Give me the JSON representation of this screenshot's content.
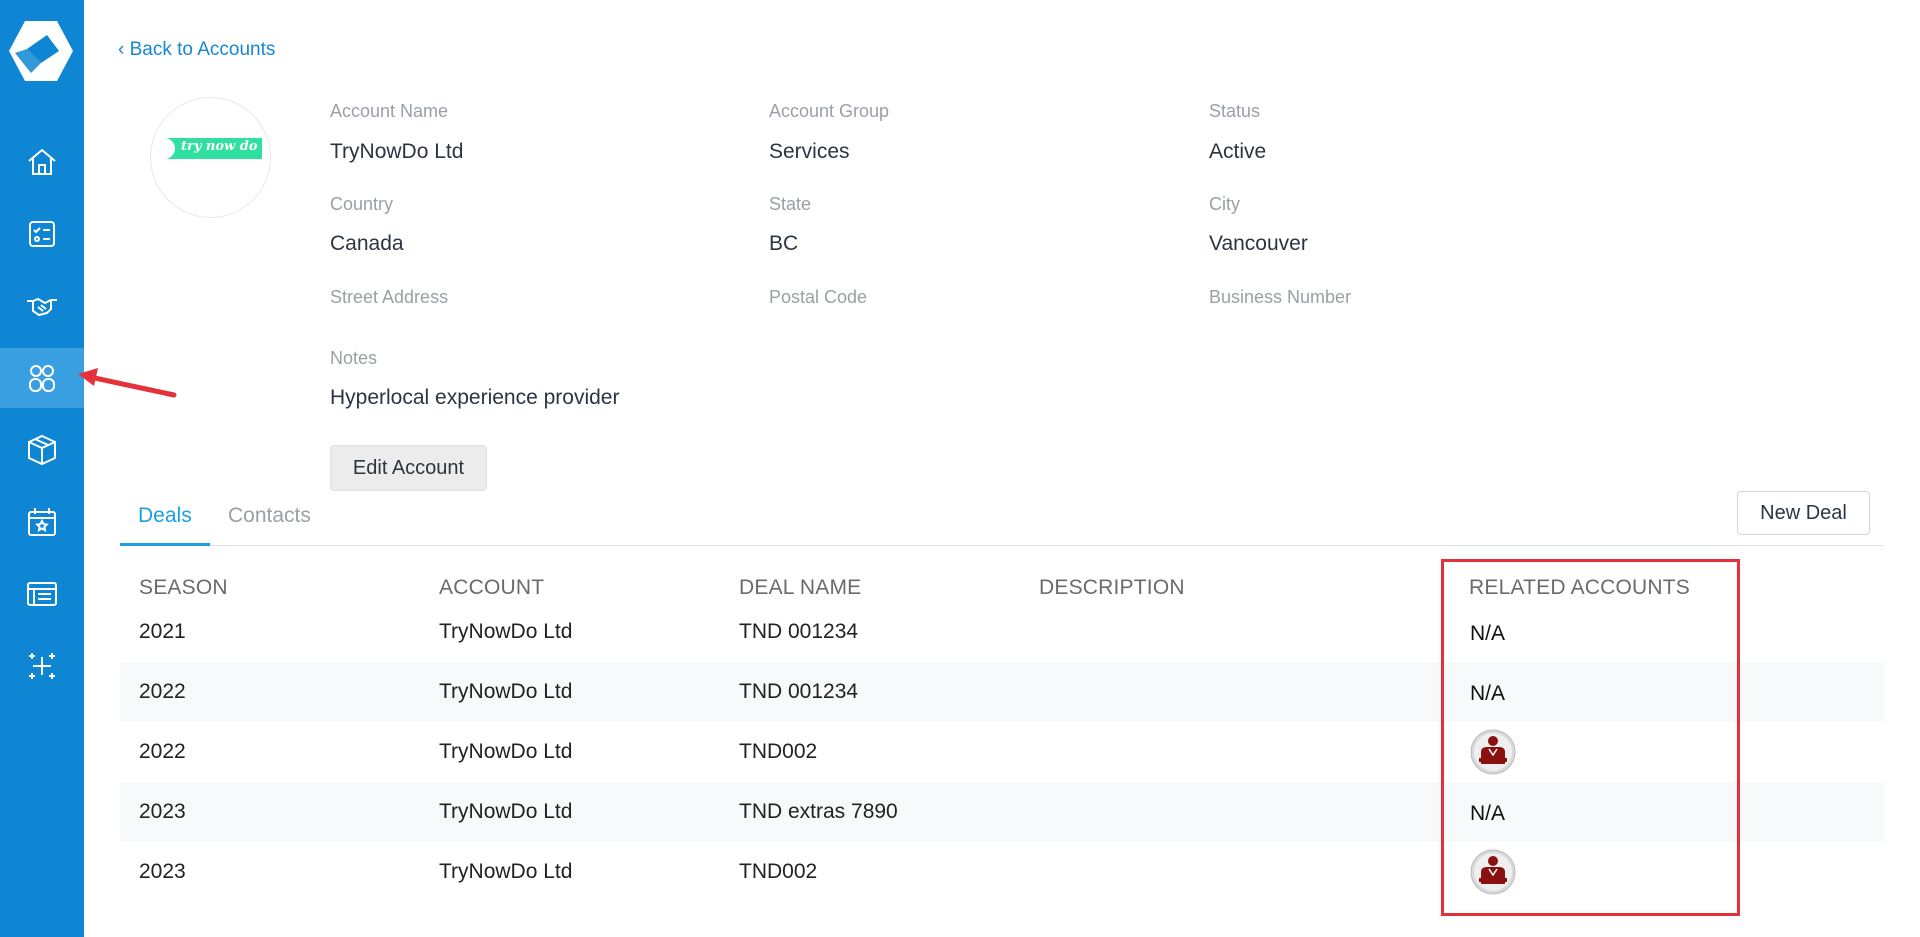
{
  "sidebar": {
    "items": [
      {
        "icon": "home-icon"
      },
      {
        "icon": "checklist-icon"
      },
      {
        "icon": "handshake-icon"
      },
      {
        "icon": "accounts-icon",
        "active": true
      },
      {
        "icon": "box-icon"
      },
      {
        "icon": "calendar-star-icon"
      },
      {
        "icon": "list-panel-icon"
      },
      {
        "icon": "sparkle-icon"
      }
    ]
  },
  "header": {
    "back_label": "Back to Accounts"
  },
  "account": {
    "logo_text": "try now do",
    "fields": {
      "account_name_label": "Account Name",
      "account_name": "TryNowDo Ltd",
      "account_group_label": "Account Group",
      "account_group": "Services",
      "status_label": "Status",
      "status": "Active",
      "country_label": "Country",
      "country": "Canada",
      "state_label": "State",
      "state": "BC",
      "city_label": "City",
      "city": "Vancouver",
      "street_label": "Street Address",
      "postal_label": "Postal Code",
      "business_label": "Business Number",
      "notes_label": "Notes",
      "notes": "Hyperlocal experience provider"
    },
    "edit_label": "Edit Account"
  },
  "tabs": {
    "deals": "Deals",
    "contacts": "Contacts",
    "active": "Deals"
  },
  "new_deal_label": "New Deal",
  "table": {
    "headers": [
      "SEASON",
      "ACCOUNT",
      "DEAL NAME",
      "DESCRIPTION",
      "RELATED ACCOUNTS"
    ],
    "rows": [
      {
        "season": "2021",
        "account": "TryNowDo Ltd",
        "deal": "TND 001234",
        "description": "",
        "related": "N/A"
      },
      {
        "season": "2022",
        "account": "TryNowDo Ltd",
        "deal": "TND 001234",
        "description": "",
        "related": "N/A"
      },
      {
        "season": "2022",
        "account": "TryNowDo Ltd",
        "deal": "TND002",
        "description": "",
        "related": "person-icon"
      },
      {
        "season": "2023",
        "account": "TryNowDo Ltd",
        "deal": "TND extras 7890",
        "description": "",
        "related": "N/A"
      },
      {
        "season": "2023",
        "account": "TryNowDo Ltd",
        "deal": "TND002",
        "description": "",
        "related": "person-icon"
      }
    ]
  },
  "colors": {
    "sidebar": "#0f86d3",
    "accent": "#1ba1df",
    "highlight": "#e4323c"
  }
}
